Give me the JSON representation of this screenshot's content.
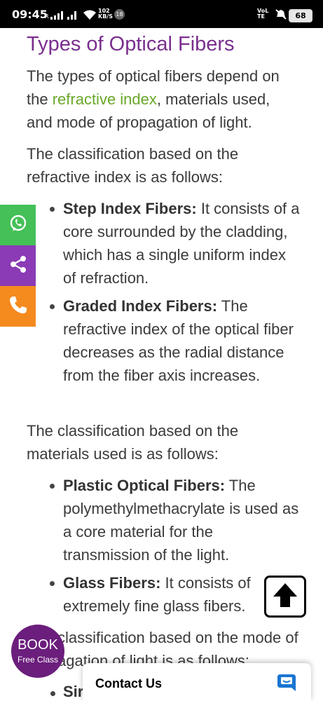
{
  "status_bar": {
    "time": "09:45",
    "speed_value": "102",
    "speed_unit": "KB/S",
    "notif_count": "18",
    "volte": "VoLTE",
    "battery": "68",
    "icons": [
      "signal-icon",
      "wifi-icon",
      "mute-icon",
      "battery-icon"
    ]
  },
  "article": {
    "title": "Types of Optical Fibers",
    "intro_before_link": "The types of optical fibers depend on the ",
    "intro_link": "refractive index",
    "intro_after_link": ", materials used, and mode of propagation of light.",
    "refractive_intro": "The classification based on the refractive index is as follows:",
    "refractive_items": [
      {
        "term": "Step Index Fibers:",
        "text": " It consists of a core surrounded by the cladding, which has a single uniform index of refraction."
      },
      {
        "term": "Graded Index Fibers:",
        "text": " The refractive index of the optical fiber decreases as the radial distance from the fiber axis increases."
      }
    ],
    "materials_intro": "The classification based on the materials used is as follows:",
    "materials_items": [
      {
        "term": "Plastic Optical Fibers:",
        "text": " The polymethylmethacrylate is used as a core material for the transmission of the light."
      },
      {
        "term": "Glass Fibers:",
        "text": " It consists of extremely fine glass fibers."
      }
    ],
    "mode_intro": "The classification based on the mode of propagation of light is as follows:",
    "mode_item_partial": "Sir"
  },
  "share_bar": {
    "buttons": [
      "whatsapp-icon",
      "share-icon",
      "phone-icon"
    ],
    "colors": {
      "whatsapp": "#44c057",
      "share": "#8a3bb5",
      "phone": "#f58a1f"
    }
  },
  "book_button": {
    "title": "BOOK",
    "subtitle": "Free Class",
    "color": "#6b1e7c"
  },
  "contact_bar": {
    "label": "Contact Us",
    "icon": "chat-icon",
    "accent": "#1976d2"
  },
  "scroll_top": {
    "icon": "arrow-up-icon"
  },
  "colors": {
    "title": "#7a2f8e",
    "link": "#6aa72a",
    "text": "#3b3b3b"
  }
}
